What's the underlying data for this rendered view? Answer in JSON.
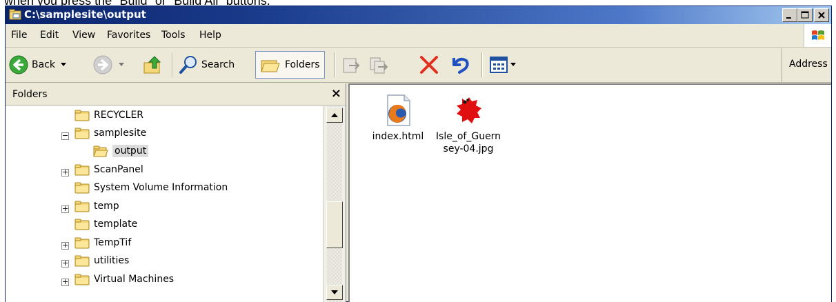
{
  "caption": "when you press the \"Build\" or \"Build All\" buttons.",
  "window": {
    "title": "C:\\samplesite\\output"
  },
  "menu": [
    "File",
    "Edit",
    "View",
    "Favorites",
    "Tools",
    "Help"
  ],
  "toolbar": {
    "back_label": "Back",
    "search_label": "Search",
    "folders_label": "Folders",
    "address_label": "Address"
  },
  "folders_pane": {
    "title": "Folders",
    "close": "×",
    "items": [
      {
        "label": "RECYCLER",
        "expander": ""
      },
      {
        "label": "samplesite",
        "expander": "−"
      },
      {
        "label": "output",
        "expander": "",
        "selected": true
      },
      {
        "label": "ScanPanel",
        "expander": "+"
      },
      {
        "label": "System Volume Information",
        "expander": ""
      },
      {
        "label": "temp",
        "expander": "+"
      },
      {
        "label": "template",
        "expander": ""
      },
      {
        "label": "TempTif",
        "expander": "+"
      },
      {
        "label": "utilities",
        "expander": "+"
      },
      {
        "label": "Virtual Machines",
        "expander": "+"
      }
    ]
  },
  "files": [
    {
      "name_line1": "index.html",
      "name_line2": "",
      "icon": "firefox-html-icon"
    },
    {
      "name_line1": "Isle_of_Guern",
      "name_line2": "sey-04.jpg",
      "icon": "island-image-icon"
    }
  ],
  "colors": {
    "title_bar": "#0a246a",
    "selected_item_bg": "#dcdcdc",
    "folder_yellow": "#f5d87a",
    "delete_red": "#e03020"
  }
}
